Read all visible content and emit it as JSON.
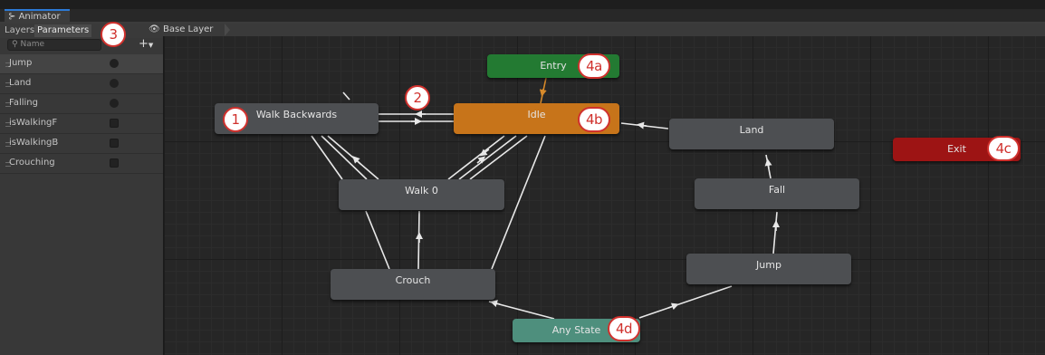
{
  "window": {
    "title": "Animator",
    "icon": "animator-graph-icon"
  },
  "panel": {
    "tabs": [
      {
        "label": "Layers",
        "active": false
      },
      {
        "label": "Parameters",
        "active": true
      }
    ],
    "search_placeholder": "Name",
    "add_label": "+",
    "parameters": [
      {
        "name": "Jump",
        "type": "trigger"
      },
      {
        "name": "Land",
        "type": "trigger"
      },
      {
        "name": "Falling",
        "type": "trigger"
      },
      {
        "name": "isWalkingF",
        "type": "bool"
      },
      {
        "name": "isWalkingB",
        "type": "bool"
      },
      {
        "name": "Crouching",
        "type": "bool"
      }
    ]
  },
  "breadcrumb": {
    "label": "Base Layer"
  },
  "states": {
    "entry": "Entry",
    "idle": "Idle",
    "walk_backwards": "Walk Backwards",
    "walk": "Walk 0",
    "crouch": "Crouch",
    "any_state": "Any State",
    "land": "Land",
    "fall": "Fall",
    "jump": "Jump",
    "exit": "Exit"
  },
  "annotations": {
    "a1": "1",
    "a2": "2",
    "a3": "3",
    "a4a": "4a",
    "a4b": "4b",
    "a4c": "4c",
    "a4d": "4d"
  },
  "colors": {
    "entry": "#237a32",
    "idle": "#c7741a",
    "exit": "#9d1414",
    "any_state": "#4e8f7d",
    "state": "#4d4f52",
    "annotation": "#d0312d"
  }
}
